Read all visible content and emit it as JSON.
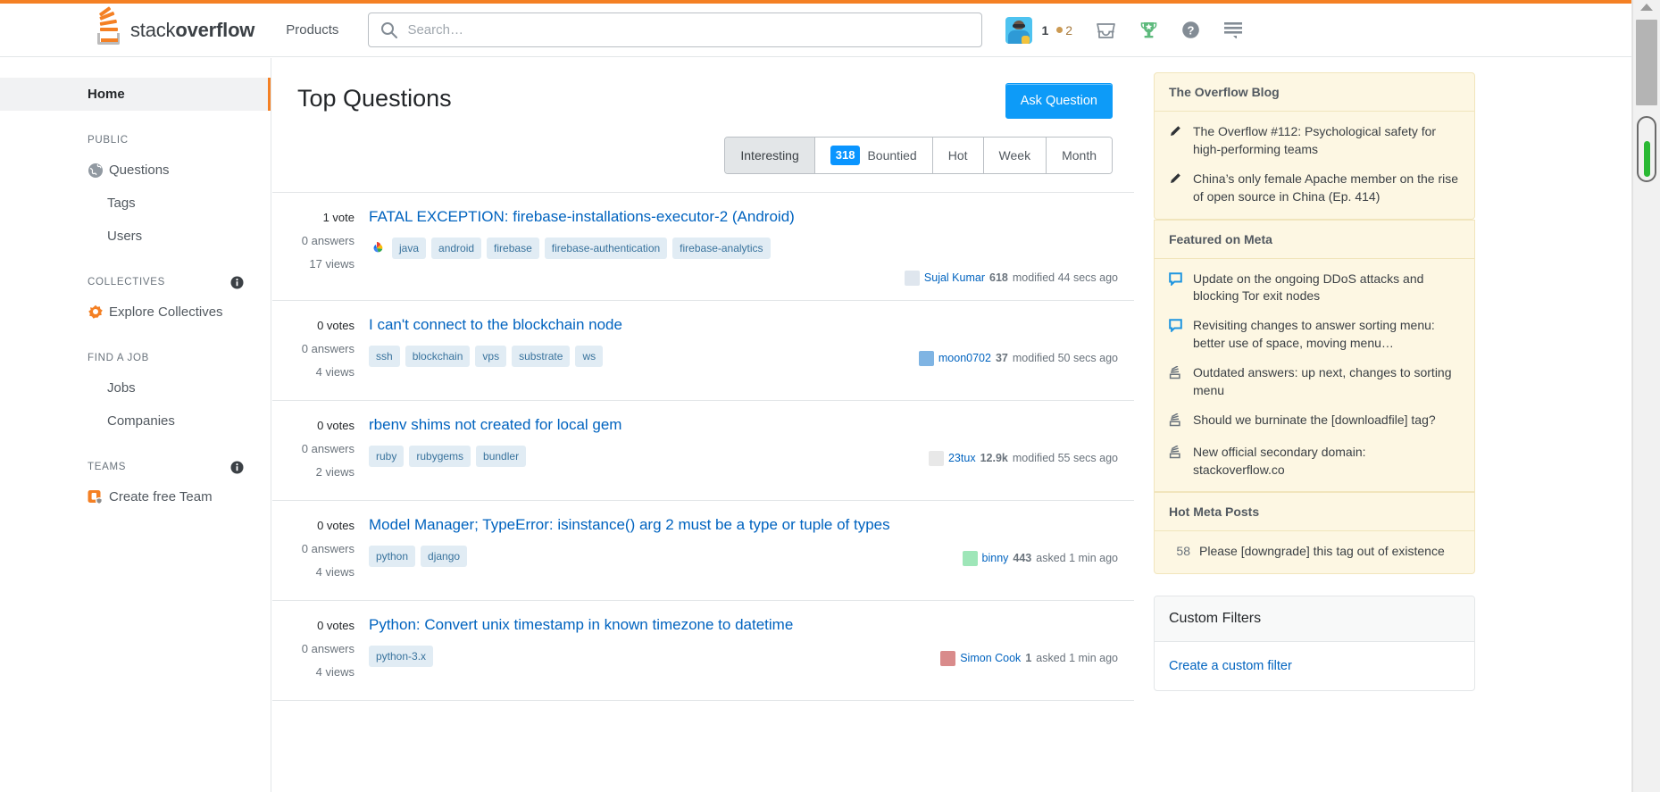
{
  "header": {
    "logo_text_light": "stack",
    "logo_text_bold": "overflow",
    "products_label": "Products",
    "search_placeholder": "Search…",
    "search_value": "",
    "reputation": "1",
    "badge_count": "2",
    "icons": [
      "search-icon",
      "inbox-icon",
      "trophy-icon",
      "help-icon",
      "hamburger-icon"
    ]
  },
  "sidebar": {
    "home_label": "Home",
    "sections": [
      {
        "title": "PUBLIC",
        "has_info": false,
        "items": [
          {
            "label": "Questions",
            "icon": "globe-icon",
            "nested": false
          },
          {
            "label": "Tags",
            "icon": "",
            "nested": true
          },
          {
            "label": "Users",
            "icon": "",
            "nested": true
          }
        ]
      },
      {
        "title": "COLLECTIVES",
        "has_info": true,
        "items": [
          {
            "label": "Explore Collectives",
            "icon": "collectives-icon",
            "nested": false
          }
        ]
      },
      {
        "title": "FIND A JOB",
        "has_info": false,
        "items": [
          {
            "label": "Jobs",
            "icon": "",
            "nested": true
          },
          {
            "label": "Companies",
            "icon": "",
            "nested": true
          }
        ]
      },
      {
        "title": "TEAMS",
        "has_info": true,
        "items": [
          {
            "label": "Create free Team",
            "icon": "teams-icon",
            "nested": false
          }
        ]
      }
    ]
  },
  "main": {
    "page_title": "Top Questions",
    "ask_button": "Ask Question",
    "tabs": [
      {
        "label": "Interesting",
        "count": "",
        "selected": true
      },
      {
        "label": "Bountied",
        "count": "318",
        "selected": false
      },
      {
        "label": "Hot",
        "count": "",
        "selected": false
      },
      {
        "label": "Week",
        "count": "",
        "selected": false
      },
      {
        "label": "Month",
        "count": "",
        "selected": false
      }
    ],
    "questions": [
      {
        "votes": "1 vote",
        "answers": "0 answers",
        "views": "17 views",
        "title": "FATAL EXCEPTION: firebase-installations-executor-2 (Android)",
        "collective_icon": "google-cloud-collective-icon",
        "tags": [
          "java",
          "android",
          "firebase",
          "firebase-authentication",
          "firebase-analytics"
        ],
        "user": "Sujal Kumar",
        "user_rep": "618",
        "action": "modified 44 secs ago",
        "avatar_color": "#dfe6ee"
      },
      {
        "votes": "0 votes",
        "answers": "0 answers",
        "views": "4 views",
        "title": "I can't connect to the blockchain node",
        "collective_icon": "",
        "tags": [
          "ssh",
          "blockchain",
          "vps",
          "substrate",
          "ws"
        ],
        "user": "moon0702",
        "user_rep": "37",
        "action": "modified 50 secs ago",
        "avatar_color": "#7fb4e3"
      },
      {
        "votes": "0 votes",
        "answers": "0 answers",
        "views": "2 views",
        "title": "rbenv shims not created for local gem",
        "collective_icon": "",
        "tags": [
          "ruby",
          "rubygems",
          "bundler"
        ],
        "user": "23tux",
        "user_rep": "12.9k",
        "action": "modified 55 secs ago",
        "avatar_color": "#e8e8e8"
      },
      {
        "votes": "0 votes",
        "answers": "0 answers",
        "views": "4 views",
        "title": "Model Manager; TypeError: isinstance() arg 2 must be a type or tuple of types",
        "collective_icon": "",
        "tags": [
          "python",
          "django"
        ],
        "user": "binny",
        "user_rep": "443",
        "action": "asked 1 min ago",
        "avatar_color": "#9ee6b8"
      },
      {
        "votes": "0 votes",
        "answers": "0 answers",
        "views": "4 views",
        "title": "Python: Convert unix timestamp in known timezone to datetime",
        "collective_icon": "",
        "tags": [
          "python-3.x"
        ],
        "user": "Simon Cook",
        "user_rep": "1",
        "action": "asked 1 min ago",
        "avatar_color": "#d98b8b"
      }
    ]
  },
  "right_sidebar": {
    "blog": {
      "title": "The Overflow Blog",
      "items": [
        {
          "icon": "pencil-icon",
          "text": "The Overflow #112: Psychological safety for high-performing teams"
        },
        {
          "icon": "pencil-icon",
          "text": "China’s only female Apache member on the rise of open source in China (Ep. 414)"
        }
      ]
    },
    "meta": {
      "title": "Featured on Meta",
      "items": [
        {
          "icon": "speech-bubble-icon",
          "text": "Update on the ongoing DDoS attacks and blocking Tor exit nodes"
        },
        {
          "icon": "speech-bubble-icon",
          "text": "Revisiting changes to answer sorting menu: better use of space, moving menu…"
        },
        {
          "icon": "stacks-icon",
          "text": "Outdated answers: up next, changes to sorting menu"
        },
        {
          "icon": "stacks-icon",
          "text": "Should we burninate the [downloadfile] tag?"
        },
        {
          "icon": "stacks-icon",
          "text": "New official secondary domain: stackoverflow.co"
        }
      ]
    },
    "hot_meta": {
      "title": "Hot Meta Posts",
      "items": [
        {
          "score": "58",
          "text": "Please [downgrade] this tag out of existence"
        }
      ]
    },
    "custom_filters": {
      "title": "Custom Filters",
      "link": "Create a custom filter"
    }
  },
  "colors": {
    "accent_orange": "#f48024",
    "link_blue": "#0063bf",
    "ask_button_blue": "#0d9bf8",
    "tag_bg": "#e1ecf4",
    "tag_text": "#39739d",
    "card_cream": "#fdf7e3",
    "badge_blue": "#0a95ff"
  }
}
